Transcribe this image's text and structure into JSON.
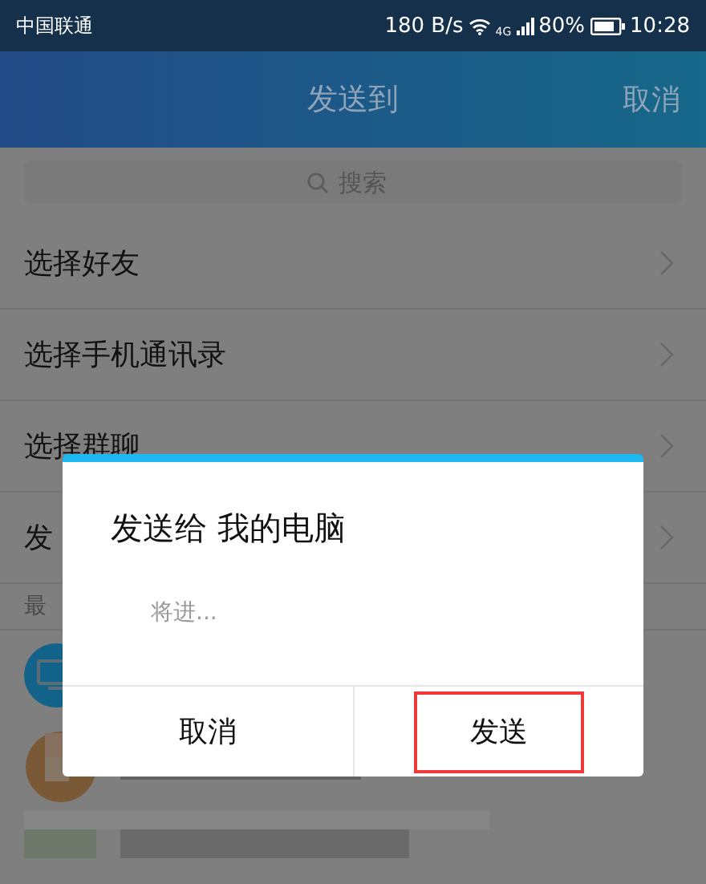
{
  "status_bar": {
    "carrier": "中国联通",
    "speed": "180 B/s",
    "network": "4G",
    "battery": "80%",
    "time": "10:28"
  },
  "header": {
    "title": "发送到",
    "cancel": "取消"
  },
  "search": {
    "placeholder": "搜索"
  },
  "menu_items": [
    {
      "label": "选择好友"
    },
    {
      "label": "选择手机通讯录"
    },
    {
      "label": "选择群聊"
    },
    {
      "label": "发"
    }
  ],
  "recent": {
    "header": "最"
  },
  "dialog": {
    "title": "发送给 我的电脑",
    "placeholder": "将进...",
    "buttons": [
      {
        "label": "取消",
        "highlighted": false
      },
      {
        "label": "发送",
        "highlighted": true
      }
    ]
  }
}
